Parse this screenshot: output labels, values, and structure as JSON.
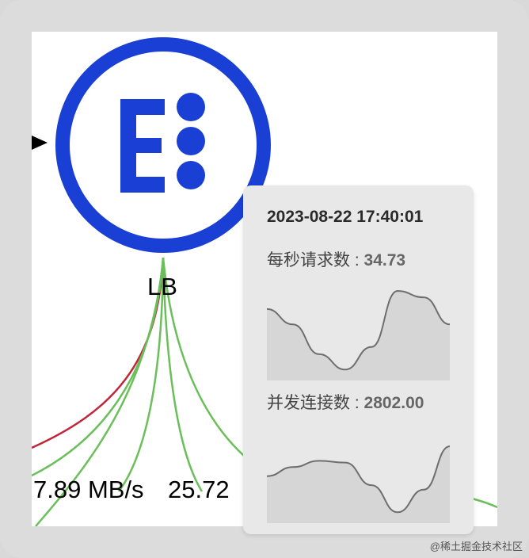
{
  "node": {
    "label": "LB",
    "icon": "elastic-e-dots-icon",
    "ring_color": "#1a3fd4"
  },
  "edges": {
    "label_throughput": "7.89 MB/s",
    "label_rate": "25.72",
    "error_color": "#c0253a",
    "ok_color": "#6bbf5a"
  },
  "tooltip": {
    "timestamp": "2023-08-22 17:40:01",
    "metric1": {
      "label": "每秒请求数 : ",
      "value": "34.73",
      "trend": [
        0.72,
        0.55,
        0.22,
        0.05,
        0.3,
        0.92,
        0.85,
        0.55
      ]
    },
    "metric2": {
      "label": "并发连接数 : ",
      "value": "2802.00",
      "trend": [
        0.45,
        0.55,
        0.62,
        0.6,
        0.35,
        0.05,
        0.3,
        0.78
      ]
    }
  },
  "watermark": "@稀土掘金技术社区"
}
